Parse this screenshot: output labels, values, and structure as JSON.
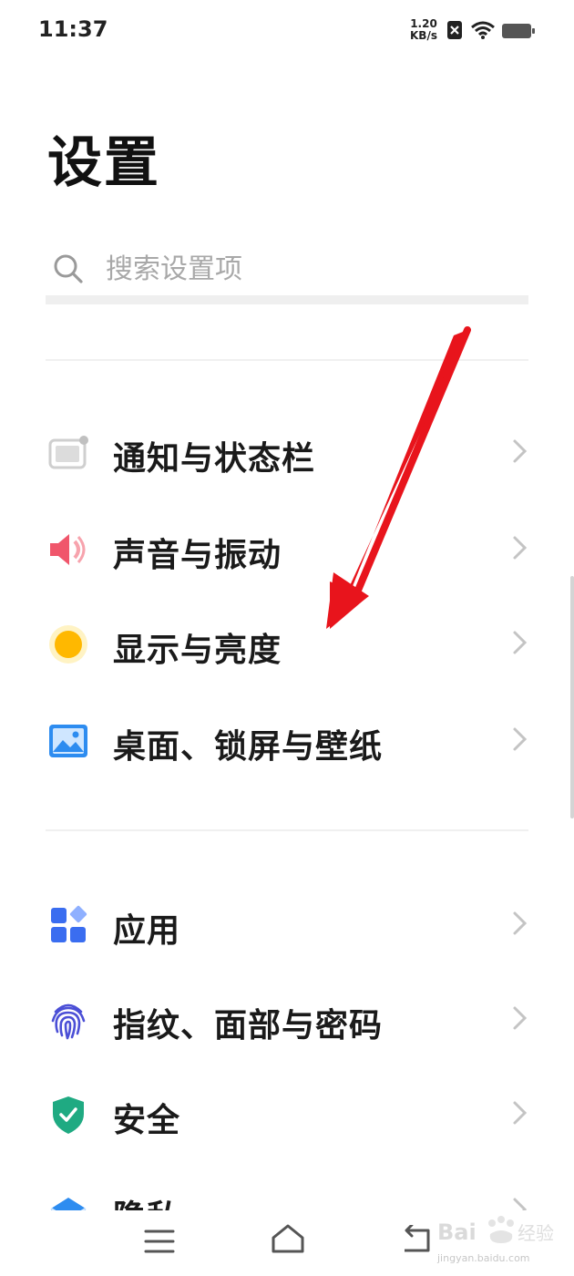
{
  "status_bar": {
    "time": "11:37",
    "net_speed_value": "1.20",
    "net_speed_unit": "KB/s"
  },
  "page": {
    "title": "设置"
  },
  "search": {
    "placeholder": "搜索设置项"
  },
  "settings_groups": [
    {
      "items": [
        {
          "label": "通知与状态栏",
          "icon": "notification-icon",
          "icon_color": "#c8c8c8"
        },
        {
          "label": "声音与振动",
          "icon": "speaker-icon",
          "icon_color": "#f0566b"
        },
        {
          "label": "显示与亮度",
          "icon": "brightness-icon",
          "icon_color": "#ffb800"
        },
        {
          "label": "桌面、锁屏与壁纸",
          "icon": "wallpaper-icon",
          "icon_color": "#2d8cf0"
        }
      ]
    },
    {
      "items": [
        {
          "label": "应用",
          "icon": "apps-icon",
          "icon_color": "#3a6df0"
        },
        {
          "label": "指纹、面部与密码",
          "icon": "fingerprint-icon",
          "icon_color": "#4b4fd6"
        },
        {
          "label": "安全",
          "icon": "shield-icon",
          "icon_color": "#1faa82"
        },
        {
          "label": "隐私",
          "icon": "privacy-icon",
          "icon_color": "#2d8cf0"
        }
      ]
    }
  ],
  "navigation_bar": {
    "buttons": [
      "menu-icon",
      "home-icon",
      "back-icon"
    ]
  },
  "annotation": {
    "arrow_color": "#e8141c"
  },
  "watermark": {
    "brand": "Bai 经验",
    "url": "jingyan.baidu.com"
  }
}
